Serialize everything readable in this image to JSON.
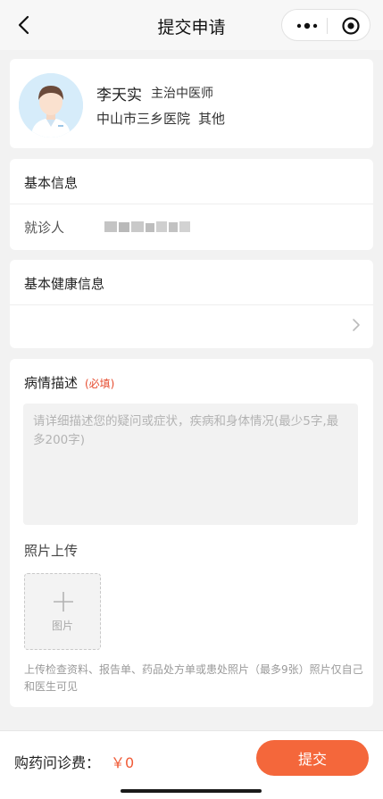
{
  "nav": {
    "title": "提交申请",
    "icons": {
      "back": "chevron-left-icon",
      "more": "more-dots-icon",
      "close": "target-circle-icon"
    }
  },
  "doctor": {
    "name": "李天实",
    "title": "主治中医师",
    "hospital": "中山市三乡医院",
    "department": "其他"
  },
  "basic_info": {
    "title": "基本信息",
    "patient_label": "就诊人"
  },
  "health_info": {
    "title": "基本健康信息"
  },
  "description": {
    "title": "病情描述",
    "required_tag": "(必填)",
    "placeholder": "请详细描述您的疑问或症状，疾病和身体情况(最少5字,最多200字)",
    "value": ""
  },
  "photos": {
    "title": "照片上传",
    "upload_label": "图片",
    "hint": "上传检查资料、报告单、药品处方单或患处照片（最多9张）照片仅自己和医生可见"
  },
  "footer": {
    "fee_label": "购药问诊费：",
    "fee_value": "￥0",
    "submit_label": "提交"
  },
  "colors": {
    "accent": "#f4673b",
    "required": "#e64b2e",
    "price": "#f05a36"
  }
}
